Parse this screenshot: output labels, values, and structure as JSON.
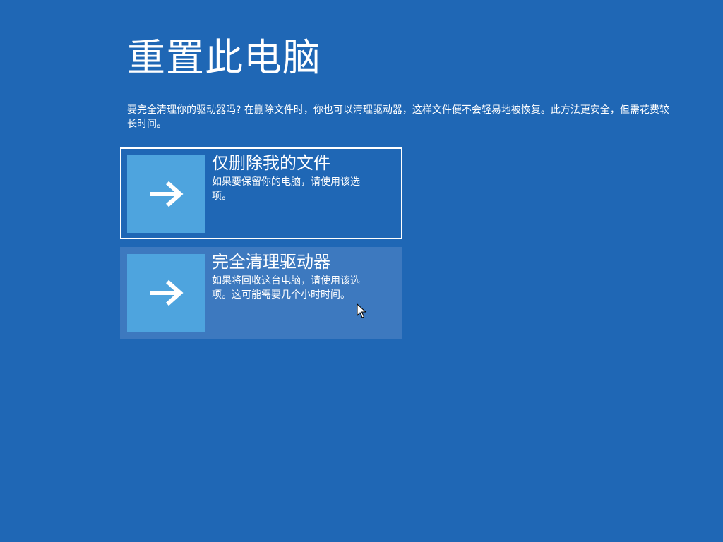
{
  "page": {
    "title": "重置此电脑",
    "description": "要完全清理你的驱动器吗? 在删除文件时，你也可以清理驱动器，这样文件便不会轻易地被恢复。此方法更安全，但需花费较长时间。"
  },
  "options": [
    {
      "title": "仅删除我的文件",
      "description": "如果要保留你的电脑，请使用该选项。",
      "icon": "arrow-right-icon",
      "selected": true
    },
    {
      "title": "完全清理驱动器",
      "description": "如果将回收这台电脑，请使用该选项。这可能需要几个小时时间。",
      "icon": "arrow-right-icon",
      "hovered": true
    }
  ],
  "colors": {
    "background": "#1f67b5",
    "tile": "#4ea4de",
    "hover": "#3d79bf",
    "text": "#ffffff"
  }
}
